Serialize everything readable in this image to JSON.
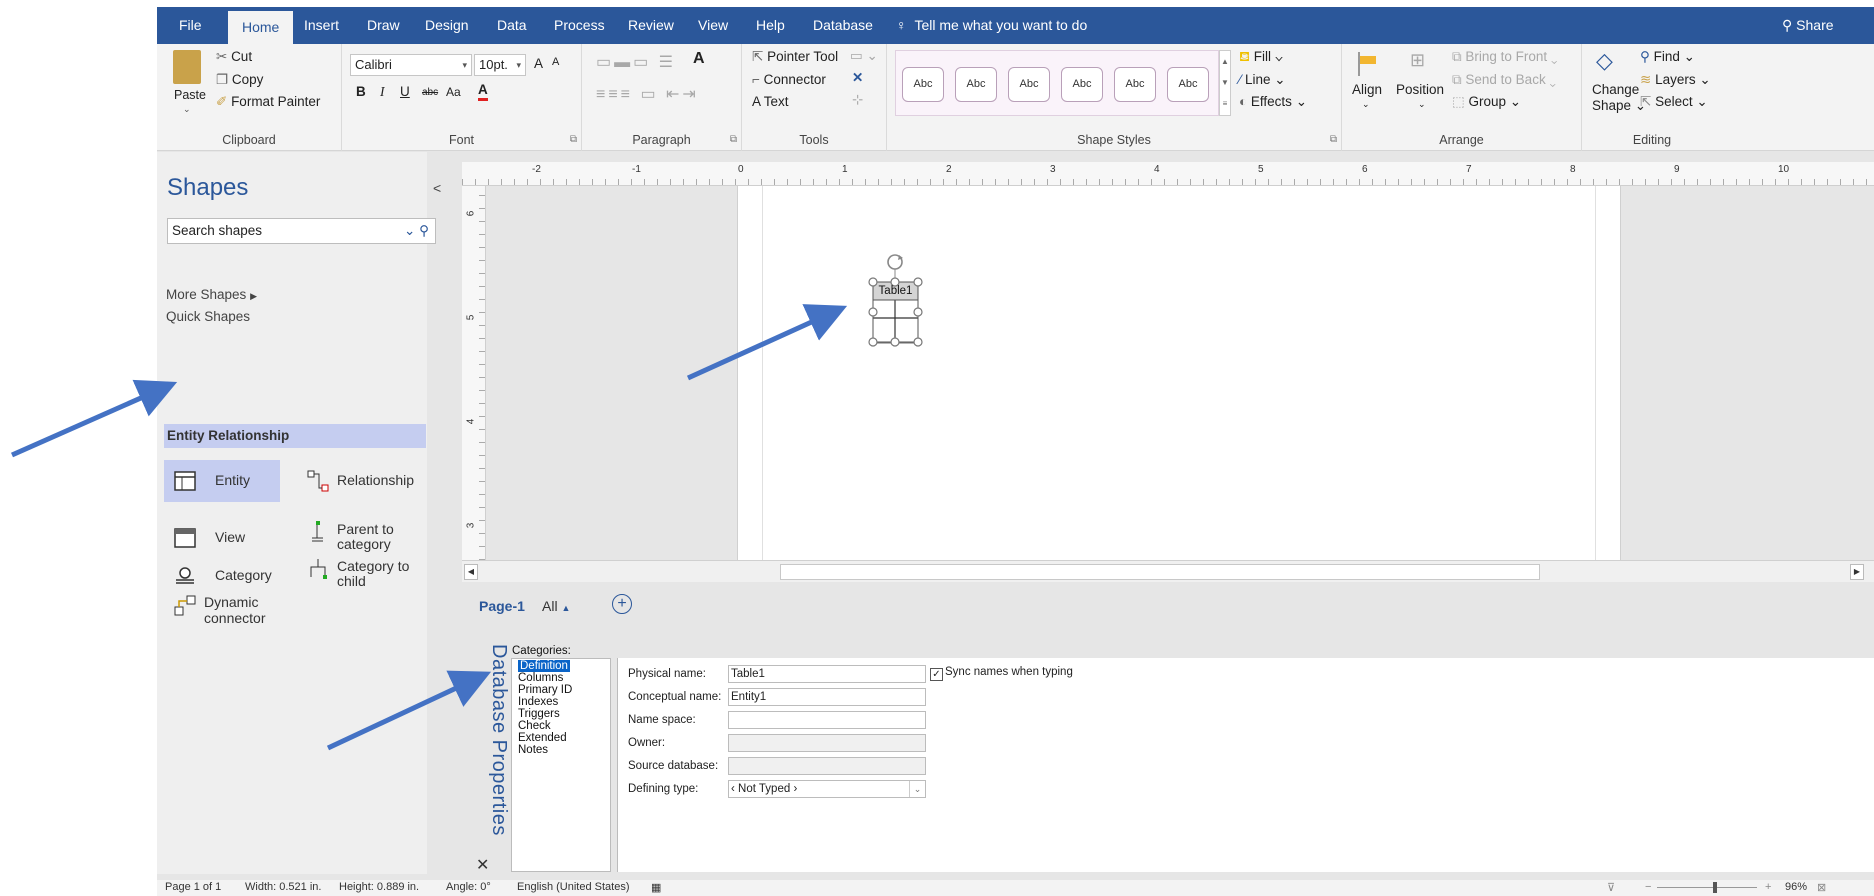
{
  "tabs": [
    "File",
    "Home",
    "Insert",
    "Draw",
    "Design",
    "Data",
    "Process",
    "Review",
    "View",
    "Help",
    "Database"
  ],
  "tell_me": "Tell me what you want to do",
  "share": "Share",
  "clipboard": {
    "paste": "Paste",
    "cut": "Cut",
    "copy": "Copy",
    "format_painter": "Format Painter",
    "label": "Clipboard"
  },
  "font": {
    "family": "Calibri",
    "size": "10pt.",
    "bold": "B",
    "italic": "I",
    "underline": "U",
    "strike": "abc",
    "case": "Aa",
    "color": "A",
    "grow": "A",
    "shrink": "A",
    "label": "Font"
  },
  "paragraph": {
    "label": "Paragraph"
  },
  "tools": {
    "pointer": "Pointer Tool",
    "connector": "Connector",
    "text": "Text",
    "label": "Tools"
  },
  "shape_styles": {
    "sample": "Abc",
    "fill": "Fill",
    "line": "Line",
    "effects": "Effects",
    "label": "Shape Styles"
  },
  "arrange": {
    "align": "Align",
    "position": "Position",
    "bring_front": "Bring to Front",
    "send_back": "Send to Back",
    "group": "Group",
    "label": "Arrange"
  },
  "editing": {
    "change_shape_1": "Change",
    "change_shape_2": "Shape",
    "find": "Find",
    "layers": "Layers",
    "select": "Select",
    "label": "Editing"
  },
  "shapes_pane": {
    "title": "Shapes",
    "search_placeholder": "Search shapes",
    "more_shapes": "More Shapes",
    "quick_shapes": "Quick Shapes",
    "entity_relationship": "Entity Relationship",
    "items": [
      {
        "label": "Entity"
      },
      {
        "label": "Relationship"
      },
      {
        "label": "View"
      },
      {
        "label": "Parent to category"
      },
      {
        "label": "Category"
      },
      {
        "label": "Category to child"
      },
      {
        "label": "Dynamic connector"
      }
    ]
  },
  "rulers": {
    "h": [
      "-2",
      "-1",
      "0",
      "1",
      "2",
      "3",
      "4",
      "5",
      "6",
      "7",
      "8",
      "9",
      "10"
    ],
    "v": [
      "6",
      "5",
      "4",
      "3"
    ]
  },
  "table_shape": {
    "title": "Table1"
  },
  "page_tabs": {
    "page1": "Page-1",
    "all": "All"
  },
  "db_properties": {
    "title": "Database Properties",
    "categories_label": "Categories:",
    "categories": [
      "Definition",
      "Columns",
      "Primary ID",
      "Indexes",
      "Triggers",
      "Check",
      "Extended",
      "Notes"
    ],
    "fields": {
      "physical_name_label": "Physical name:",
      "physical_name": "Table1",
      "sync_label": "Sync names when typing",
      "conceptual_name_label": "Conceptual name:",
      "conceptual_name": "Entity1",
      "name_space_label": "Name space:",
      "owner_label": "Owner:",
      "source_db_label": "Source database:",
      "defining_type_label": "Defining type:",
      "defining_type": "Not Typed"
    }
  },
  "status": {
    "page": "Page 1 of 1",
    "width": "Width: 0.521 in.",
    "height": "Height: 0.889 in.",
    "angle": "Angle: 0°",
    "language": "English (United States)",
    "zoom": "96%"
  },
  "colors": {
    "accent": "#2b579a",
    "annotation_arrow": "#4472c4",
    "selected_stencil": "#c5cdf0"
  }
}
